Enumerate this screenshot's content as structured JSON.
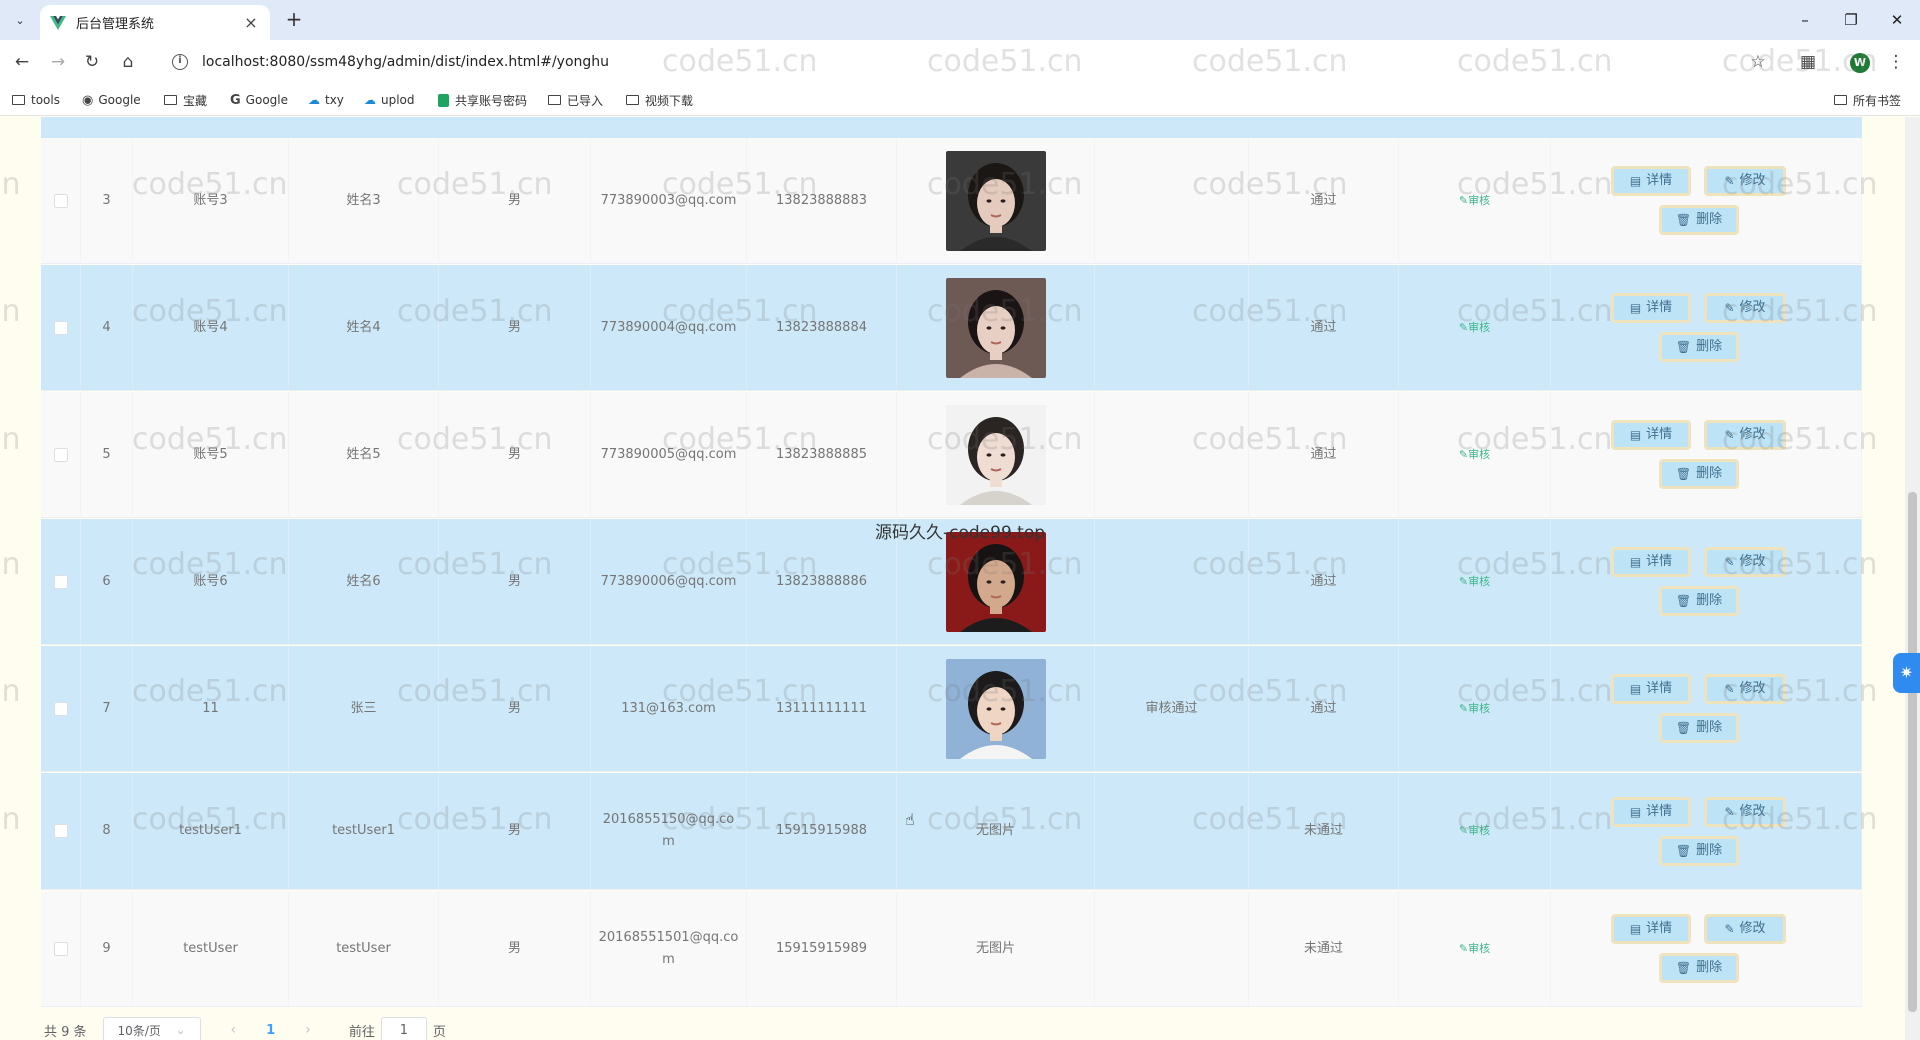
{
  "browser": {
    "tab_title": "后台管理系统",
    "url": "localhost:8080/ssm48yhg/admin/dist/index.html#/yonghu",
    "profile_initial": "W",
    "bookmarks": [
      "tools",
      "Google",
      "宝藏",
      "Google",
      "txy",
      "uplod",
      "共享账号密码",
      "已导入",
      "视频下载"
    ],
    "all_bookmarks": "所有书签"
  },
  "table": {
    "rows": [
      {
        "index": "3",
        "account": "账号3",
        "name": "姓名3",
        "sex": "男",
        "email": "773890003@qq.com",
        "phone": "13823888883",
        "photo": "avatar-woman-1",
        "note": "",
        "status": "通过",
        "audit": "审核"
      },
      {
        "index": "4",
        "account": "账号4",
        "name": "姓名4",
        "sex": "男",
        "email": "773890004@qq.com",
        "phone": "13823888884",
        "photo": "avatar-woman-2",
        "note": "",
        "status": "通过",
        "audit": "审核"
      },
      {
        "index": "5",
        "account": "账号5",
        "name": "姓名5",
        "sex": "男",
        "email": "773890005@qq.com",
        "phone": "13823888885",
        "photo": "avatar-woman-3",
        "note": "",
        "status": "通过",
        "audit": "审核"
      },
      {
        "index": "6",
        "account": "账号6",
        "name": "姓名6",
        "sex": "男",
        "email": "773890006@qq.com",
        "phone": "13823888886",
        "photo": "avatar-man-1",
        "note": "",
        "status": "通过",
        "audit": "审核"
      },
      {
        "index": "7",
        "account": "11",
        "name": "张三",
        "sex": "男",
        "email": "131@163.com",
        "phone": "13111111111",
        "photo": "avatar-man-2",
        "note": "审核通过",
        "status": "通过",
        "audit": "审核"
      },
      {
        "index": "8",
        "account": "testUser1",
        "name": "testUser1",
        "sex": "男",
        "email": "2016855150@qq.com",
        "phone": "15915915988",
        "photo_text": "无图片",
        "note": "",
        "status": "未通过",
        "audit": "审核"
      },
      {
        "index": "9",
        "account": "testUser",
        "name": "testUser",
        "sex": "男",
        "email": "20168551501@qq.com",
        "phone": "15915915989",
        "photo_text": "无图片",
        "note": "",
        "status": "未通过",
        "audit": "审核"
      }
    ],
    "buttons": {
      "detail": "详情",
      "edit": "修改",
      "delete": "删除"
    }
  },
  "pagination": {
    "total": "共 9 条",
    "page_size": "10条/页",
    "current_page": "1",
    "goto_prefix": "前往",
    "goto_value": "1",
    "goto_suffix": "页"
  },
  "watermark": {
    "text": "code51.cn",
    "center_text": "源码久久-code99.top"
  }
}
